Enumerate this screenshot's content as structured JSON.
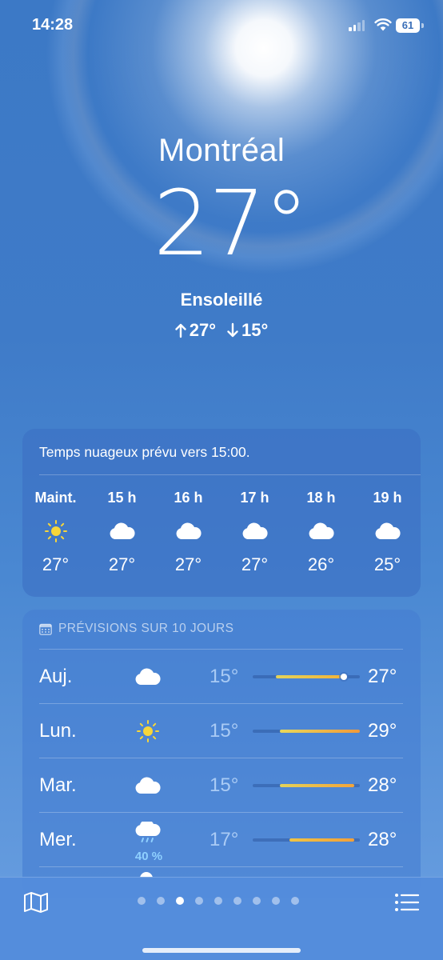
{
  "status_bar": {
    "time": "14:28",
    "battery": "61"
  },
  "current": {
    "city": "Montréal",
    "temperature": "27°",
    "condition": "Ensoleillé",
    "high": "27°",
    "low": "15°"
  },
  "hourly": {
    "summary": "Temps nuageux prévu vers 15:00.",
    "hours": [
      {
        "label": "Maint.",
        "icon": "sun-icon",
        "temp": "27°"
      },
      {
        "label": "15 h",
        "icon": "cloud-icon",
        "temp": "27°"
      },
      {
        "label": "16 h",
        "icon": "cloud-icon",
        "temp": "27°"
      },
      {
        "label": "17 h",
        "icon": "cloud-icon",
        "temp": "27°"
      },
      {
        "label": "18 h",
        "icon": "cloud-icon",
        "temp": "26°"
      },
      {
        "label": "19 h",
        "icon": "cloud-icon",
        "temp": "25°"
      }
    ]
  },
  "daily": {
    "header": "PRÉVISIONS SUR 10 JOURS",
    "days": [
      {
        "day": "Auj.",
        "icon": "cloud-icon",
        "low": "15°",
        "high": "27°",
        "range_start": 0.22,
        "range_end": 0.83,
        "current_marker": 0.85,
        "colors": [
          "#e3d35a",
          "#f1b43a"
        ]
      },
      {
        "day": "Lun.",
        "icon": "sun-icon",
        "low": "15°",
        "high": "29°",
        "range_start": 0.25,
        "range_end": 1.0,
        "colors": [
          "#e9d85a",
          "#f1993a"
        ]
      },
      {
        "day": "Mar.",
        "icon": "cloud-icon",
        "low": "15°",
        "high": "28°",
        "range_start": 0.25,
        "range_end": 0.95,
        "colors": [
          "#e3d35a",
          "#f3a43a"
        ]
      },
      {
        "day": "Mer.",
        "icon": "cloud-rain-icon",
        "precip": "40 %",
        "low": "17°",
        "high": "28°",
        "range_start": 0.34,
        "range_end": 0.95,
        "colors": [
          "#f0c444",
          "#f2a03a"
        ]
      }
    ]
  },
  "toolbar": {
    "page_count": 9,
    "active_page": 2
  }
}
